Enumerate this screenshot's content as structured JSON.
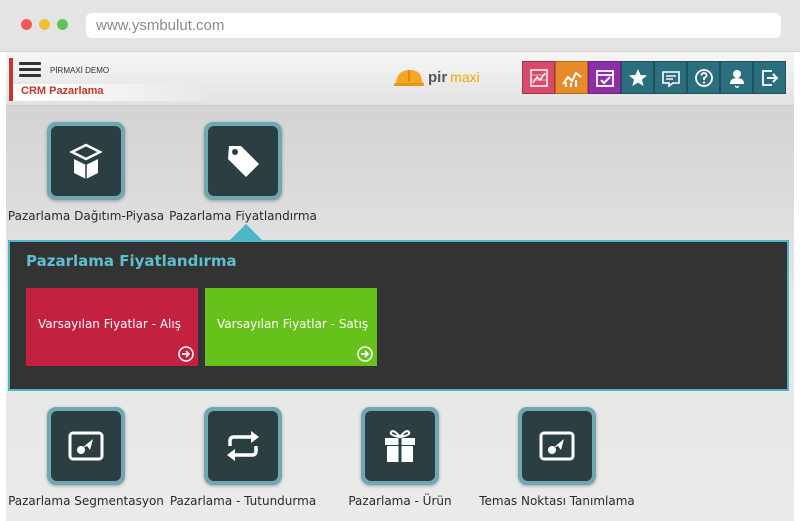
{
  "browser": {
    "url": "www.ysmbulut.com"
  },
  "header": {
    "company": "PİRMAXİ DEMO",
    "module": "CRM Pazarlama",
    "logo": {
      "pir": "pir",
      "maxi": "maxi"
    },
    "toolbar_icons": [
      "chart-icon",
      "trend-icon",
      "calendar-check-icon",
      "star-icon",
      "message-icon",
      "help-icon",
      "user-icon",
      "logout-icon"
    ]
  },
  "tiles_top": [
    {
      "label": "Pazarlama Dağıtım-Piyasa",
      "icon": "box-icon"
    },
    {
      "label": "Pazarlama Fiyatlandırma",
      "icon": "tag-icon"
    }
  ],
  "panel": {
    "title": "Pazarlama Fiyatlandırma",
    "items": [
      {
        "label": "Varsayılan Fiyatlar - Alış",
        "color": "#c4203f"
      },
      {
        "label": "Varsayılan Fiyatlar - Satış",
        "color": "#66c21b"
      }
    ]
  },
  "tiles_bottom": [
    {
      "label": "Pazarlama Segmentasyon",
      "icon": "target-screen-icon"
    },
    {
      "label": "Pazarlama - Tutundurma",
      "icon": "repeat-icon"
    },
    {
      "label": "Pazarlama - Ürün",
      "icon": "gift-icon"
    },
    {
      "label": "Temas Noktası Tanımlama",
      "icon": "target-screen-icon"
    }
  ],
  "colors": {
    "accent_teal": "#4ab6c8",
    "tile_bg": "#2b3e42",
    "brand_red": "#c0392b"
  }
}
